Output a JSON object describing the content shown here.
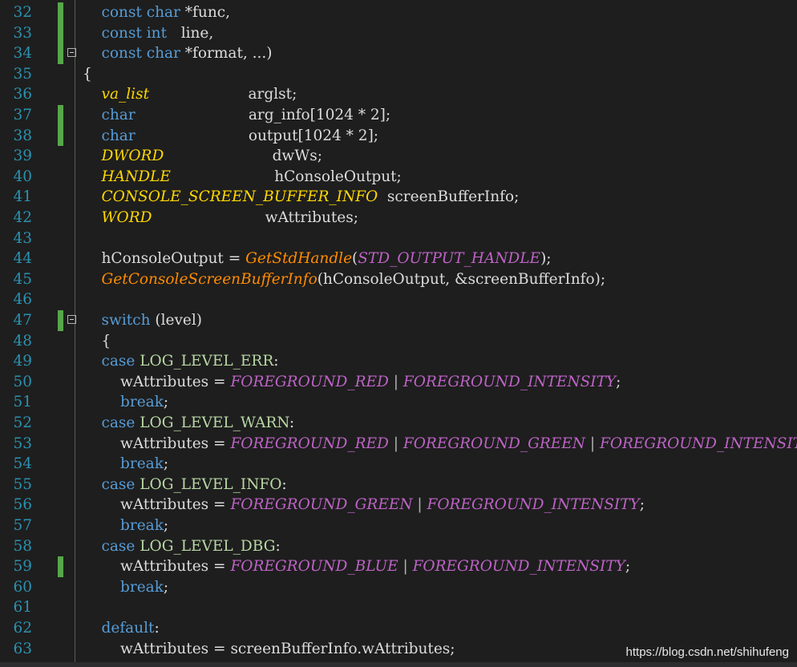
{
  "watermark": "https://blog.csdn.net/shihufeng",
  "lines": [
    {
      "n": "32",
      "mod": true,
      "fold": false,
      "tokens": [
        [
          "pl",
          "    "
        ],
        [
          "kw",
          "const "
        ],
        [
          "kw",
          "char"
        ],
        [
          "pl",
          " *func,"
        ]
      ]
    },
    {
      "n": "33",
      "mod": true,
      "fold": false,
      "tokens": [
        [
          "pl",
          "    "
        ],
        [
          "kw",
          "const "
        ],
        [
          "kw",
          "int"
        ],
        [
          "pl",
          "   line,"
        ]
      ]
    },
    {
      "n": "34",
      "mod": true,
      "fold": true,
      "tokens": [
        [
          "pl",
          "    "
        ],
        [
          "kw",
          "const "
        ],
        [
          "kw",
          "char"
        ],
        [
          "pl",
          " *format, ...)"
        ]
      ]
    },
    {
      "n": "35",
      "mod": false,
      "fold": false,
      "tokens": [
        [
          "pl",
          "{"
        ]
      ]
    },
    {
      "n": "36",
      "mod": false,
      "fold": false,
      "tokens": [
        [
          "pl",
          "    "
        ],
        [
          "ty",
          "va_list"
        ],
        [
          "pl",
          "                     arglst;"
        ]
      ]
    },
    {
      "n": "37",
      "mod": true,
      "fold": false,
      "tokens": [
        [
          "pl",
          "    "
        ],
        [
          "kw",
          "char"
        ],
        [
          "pl",
          "                        arg_info[1024 * 2];"
        ]
      ]
    },
    {
      "n": "38",
      "mod": true,
      "fold": false,
      "tokens": [
        [
          "pl",
          "    "
        ],
        [
          "kw",
          "char"
        ],
        [
          "pl",
          "                        output[1024 * 2];"
        ]
      ]
    },
    {
      "n": "39",
      "mod": false,
      "fold": false,
      "tokens": [
        [
          "pl",
          "    "
        ],
        [
          "ty",
          "DWORD"
        ],
        [
          "pl",
          "                       dwWs;"
        ]
      ]
    },
    {
      "n": "40",
      "mod": false,
      "fold": false,
      "tokens": [
        [
          "pl",
          "    "
        ],
        [
          "ty",
          "HANDLE"
        ],
        [
          "pl",
          "                      hConsoleOutput;"
        ]
      ]
    },
    {
      "n": "41",
      "mod": false,
      "fold": false,
      "tokens": [
        [
          "pl",
          "    "
        ],
        [
          "ty",
          "CONSOLE_SCREEN_BUFFER_INFO"
        ],
        [
          "pl",
          "  screenBufferInfo;"
        ]
      ]
    },
    {
      "n": "42",
      "mod": false,
      "fold": false,
      "tokens": [
        [
          "pl",
          "    "
        ],
        [
          "ty",
          "WORD"
        ],
        [
          "pl",
          "                        wAttributes;"
        ]
      ]
    },
    {
      "n": "43",
      "mod": false,
      "fold": false,
      "tokens": []
    },
    {
      "n": "44",
      "mod": false,
      "fold": false,
      "tokens": [
        [
          "pl",
          "    hConsoleOutput = "
        ],
        [
          "fn",
          "GetStdHandle"
        ],
        [
          "pl",
          "("
        ],
        [
          "mc",
          "STD_OUTPUT_HANDLE"
        ],
        [
          "pl",
          ");"
        ]
      ]
    },
    {
      "n": "45",
      "mod": false,
      "fold": false,
      "tokens": [
        [
          "pl",
          "    "
        ],
        [
          "fn",
          "GetConsoleScreenBufferInfo"
        ],
        [
          "pl",
          "(hConsoleOutput, &screenBufferInfo);"
        ]
      ]
    },
    {
      "n": "46",
      "mod": false,
      "fold": false,
      "tokens": []
    },
    {
      "n": "47",
      "mod": true,
      "fold": true,
      "tokens": [
        [
          "pl",
          "    "
        ],
        [
          "kw",
          "switch"
        ],
        [
          "pl",
          " (level)"
        ]
      ]
    },
    {
      "n": "48",
      "mod": false,
      "fold": false,
      "tokens": [
        [
          "pl",
          "    {"
        ]
      ]
    },
    {
      "n": "49",
      "mod": false,
      "fold": false,
      "tokens": [
        [
          "pl",
          "    "
        ],
        [
          "kw",
          "case "
        ],
        [
          "en",
          "LOG_LEVEL_ERR"
        ],
        [
          "pl",
          ":"
        ]
      ]
    },
    {
      "n": "50",
      "mod": false,
      "fold": false,
      "tokens": [
        [
          "pl",
          "        wAttributes = "
        ],
        [
          "mc",
          "FOREGROUND_RED"
        ],
        [
          "op",
          " | "
        ],
        [
          "mc",
          "FOREGROUND_INTENSITY"
        ],
        [
          "pl",
          ";"
        ]
      ]
    },
    {
      "n": "51",
      "mod": false,
      "fold": false,
      "tokens": [
        [
          "pl",
          "        "
        ],
        [
          "kw",
          "break"
        ],
        [
          "pl",
          ";"
        ]
      ]
    },
    {
      "n": "52",
      "mod": false,
      "fold": false,
      "tokens": [
        [
          "pl",
          "    "
        ],
        [
          "kw",
          "case "
        ],
        [
          "en",
          "LOG_LEVEL_WARN"
        ],
        [
          "pl",
          ":"
        ]
      ]
    },
    {
      "n": "53",
      "mod": false,
      "fold": false,
      "tokens": [
        [
          "pl",
          "        wAttributes = "
        ],
        [
          "mc",
          "FOREGROUND_RED"
        ],
        [
          "op",
          " | "
        ],
        [
          "mc",
          "FOREGROUND_GREEN"
        ],
        [
          "op",
          " | "
        ],
        [
          "mc",
          "FOREGROUND_INTENSITY"
        ],
        [
          "pl",
          ";"
        ]
      ]
    },
    {
      "n": "54",
      "mod": false,
      "fold": false,
      "tokens": [
        [
          "pl",
          "        "
        ],
        [
          "kw",
          "break"
        ],
        [
          "pl",
          ";"
        ]
      ]
    },
    {
      "n": "55",
      "mod": false,
      "fold": false,
      "tokens": [
        [
          "pl",
          "    "
        ],
        [
          "kw",
          "case "
        ],
        [
          "en",
          "LOG_LEVEL_INFO"
        ],
        [
          "pl",
          ":"
        ]
      ]
    },
    {
      "n": "56",
      "mod": false,
      "fold": false,
      "tokens": [
        [
          "pl",
          "        wAttributes = "
        ],
        [
          "mc",
          "FOREGROUND_GREEN"
        ],
        [
          "op",
          " | "
        ],
        [
          "mc",
          "FOREGROUND_INTENSITY"
        ],
        [
          "pl",
          ";"
        ]
      ]
    },
    {
      "n": "57",
      "mod": false,
      "fold": false,
      "tokens": [
        [
          "pl",
          "        "
        ],
        [
          "kw",
          "break"
        ],
        [
          "pl",
          ";"
        ]
      ]
    },
    {
      "n": "58",
      "mod": false,
      "fold": false,
      "tokens": [
        [
          "pl",
          "    "
        ],
        [
          "kw",
          "case "
        ],
        [
          "en",
          "LOG_LEVEL_DBG"
        ],
        [
          "pl",
          ":"
        ]
      ]
    },
    {
      "n": "59",
      "mod": true,
      "fold": false,
      "tokens": [
        [
          "pl",
          "        wAttributes = "
        ],
        [
          "mc",
          "FOREGROUND_BLUE"
        ],
        [
          "op",
          " | "
        ],
        [
          "mc",
          "FOREGROUND_INTENSITY"
        ],
        [
          "pl",
          ";"
        ]
      ]
    },
    {
      "n": "60",
      "mod": false,
      "fold": false,
      "tokens": [
        [
          "pl",
          "        "
        ],
        [
          "kw",
          "break"
        ],
        [
          "pl",
          ";"
        ]
      ]
    },
    {
      "n": "61",
      "mod": false,
      "fold": false,
      "tokens": []
    },
    {
      "n": "62",
      "mod": false,
      "fold": false,
      "tokens": [
        [
          "pl",
          "    "
        ],
        [
          "kw",
          "default"
        ],
        [
          "pl",
          ":"
        ]
      ]
    },
    {
      "n": "63",
      "mod": false,
      "fold": false,
      "tokens": [
        [
          "pl",
          "        wAttributes = screenBufferInfo.wAttributes;"
        ]
      ]
    }
  ]
}
